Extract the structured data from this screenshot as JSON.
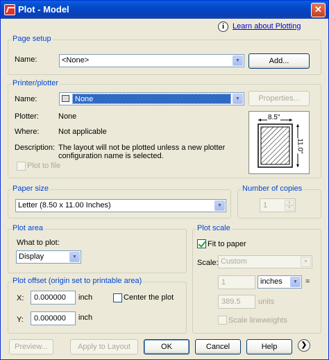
{
  "window": {
    "title": "Plot - Model",
    "close_glyph": "✕"
  },
  "info": {
    "link_text": "Learn about Plotting",
    "icon": "info-icon"
  },
  "page_setup": {
    "legend": "Page setup",
    "name_label": "Name:",
    "name_value": "<None>",
    "add_button": "Add..."
  },
  "printer": {
    "legend": "Printer/plotter",
    "name_label": "Name:",
    "name_value": "None",
    "properties_button": "Properties...",
    "plotter_label": "Plotter:",
    "plotter_value": "None",
    "where_label": "Where:",
    "where_value": "Not applicable",
    "description_label": "Description:",
    "description_line1": "The layout will not be plotted unless a new plotter",
    "description_line2": "configuration name is selected.",
    "plot_to_file_label": "Plot to file",
    "plot_to_file_checked": false,
    "preview_width": "8.5\"",
    "preview_height": "11.0\""
  },
  "paper_size": {
    "legend": "Paper size",
    "value": "Letter (8.50 x 11.00 Inches)"
  },
  "copies": {
    "legend": "Number of copies",
    "value": "1"
  },
  "plot_area": {
    "legend": "Plot area",
    "what_label": "What to plot:",
    "what_value": "Display"
  },
  "plot_offset": {
    "legend": "Plot offset (origin set to printable area)",
    "x_label": "X:",
    "x_value": "0.000000",
    "x_unit": "inch",
    "y_label": "Y:",
    "y_value": "0.000000",
    "y_unit": "inch",
    "center_label": "Center the plot",
    "center_checked": false
  },
  "plot_scale": {
    "legend": "Plot scale",
    "fit_label": "Fit to paper",
    "fit_checked": true,
    "scale_label": "Scale:",
    "scale_value": "Custom",
    "value1": "1",
    "unit1": "inches",
    "equals": "=",
    "value2": "389.5",
    "unit2": "units",
    "lineweights_label": "Scale lineweights",
    "lineweights_checked": false
  },
  "footer": {
    "preview_button": "Preview...",
    "apply_button": "Apply to Layout",
    "ok_button": "OK",
    "cancel_button": "Cancel",
    "help_button": "Help",
    "expand_glyph": "❯"
  },
  "colors": {
    "legend_blue": "#0046d5",
    "selection_blue": "#316ac5",
    "titlebar": "#0348c8"
  }
}
